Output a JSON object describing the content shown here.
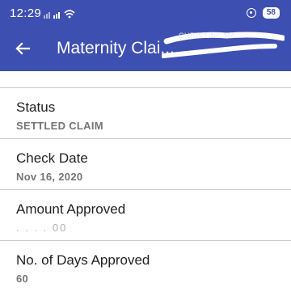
{
  "status_bar": {
    "time": "12:29",
    "battery": "58"
  },
  "app_bar": {
    "title": "Maternity Clai...",
    "redacted_name": "CHRISTINE MA..."
  },
  "fields": [
    {
      "label": "Status",
      "value": "SETTLED CLAIM"
    },
    {
      "label": "Check Date",
      "value": "Nov 16, 2020"
    },
    {
      "label": "Amount Approved",
      "value": ". . . . 00"
    },
    {
      "label": "No. of Days Approved",
      "value": "60"
    }
  ],
  "colors": {
    "app_bar": "#3e4fb2",
    "value_text": "#757575"
  }
}
